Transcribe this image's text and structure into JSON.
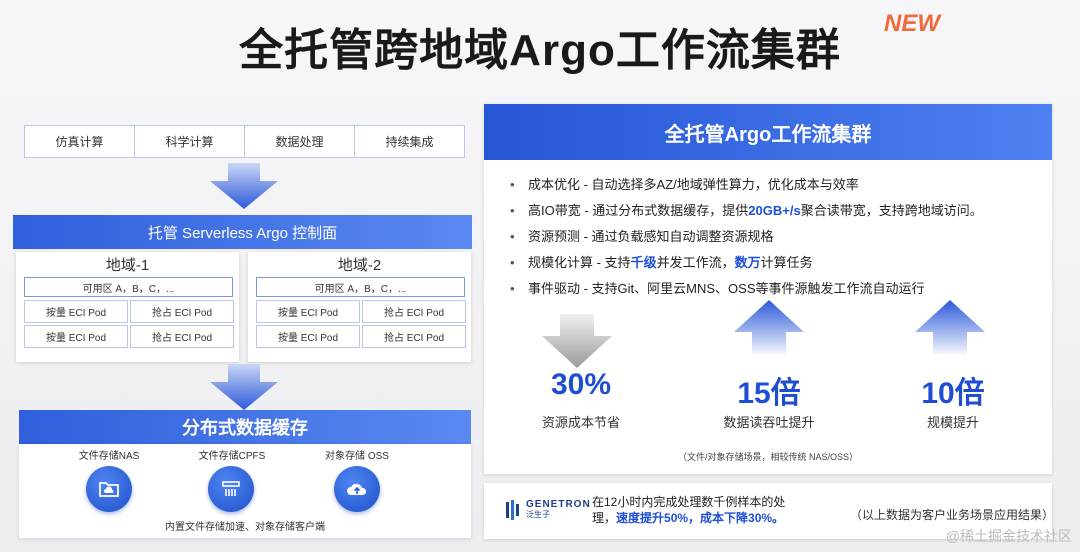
{
  "title": "全托管跨地域Argo工作流集群",
  "badge": "NEW",
  "tabs": [
    "仿真计算",
    "科学计算",
    "数据处理",
    "持续集成"
  ],
  "control_plane": "托管 Serverless Argo 控制面",
  "regions": [
    {
      "title": "地域-1",
      "az": "可用区 A，B，C，...",
      "pods": [
        "按量 ECI Pod",
        "抢占 ECI Pod",
        "按量 ECI Pod",
        "抢占 ECI Pod"
      ]
    },
    {
      "title": "地域-2",
      "az": "可用区 A，B，C，...",
      "pods": [
        "按量 ECI Pod",
        "抢占 ECI Pod",
        "按量 ECI Pod",
        "抢占 ECI Pod"
      ]
    }
  ],
  "cache": {
    "title": "分布式数据缓存",
    "stores": [
      {
        "label": "文件存储NAS",
        "icon": "folder-cloud-icon"
      },
      {
        "label": "文件存储CPFS",
        "icon": "file-storage-icon"
      },
      {
        "label": "对象存储 OSS",
        "icon": "cloud-upload-icon"
      }
    ],
    "footer": "内置文件存储加速、对象存储客户端"
  },
  "panel": {
    "title": "全托管Argo工作流集群",
    "bullets": [
      {
        "parts": [
          {
            "t": "成本优化 - 自动选择多AZ/地域弹性算力，优化成本与效率"
          }
        ]
      },
      {
        "parts": [
          {
            "t": "高IO带宽 - 通过分布式数据缓存，提供"
          },
          {
            "t": "20GB+/s",
            "hl": true
          },
          {
            "t": "聚合读带宽，支持跨地域访问。"
          }
        ]
      },
      {
        "parts": [
          {
            "t": "资源预测 - 通过负载感知自动调整资源规格"
          }
        ]
      },
      {
        "parts": [
          {
            "t": "规模化计算 - 支持"
          },
          {
            "t": "千级",
            "hl": true
          },
          {
            "t": "并发工作流，"
          },
          {
            "t": "数万",
            "hl": true
          },
          {
            "t": "计算任务"
          }
        ]
      },
      {
        "parts": [
          {
            "t": "事件驱动 - 支持Git、阿里云MNS、OSS等事件源触发工作流自动运行"
          }
        ]
      }
    ],
    "stats": [
      {
        "value": "30%",
        "label": "资源成本节省",
        "direction": "down"
      },
      {
        "value": "15倍",
        "label": "数据读吞吐提升",
        "direction": "up"
      },
      {
        "value": "10倍",
        "label": "规模提升",
        "direction": "up"
      }
    ],
    "note": "（文件/对象存储场景，相较传统 NAS/OSS）"
  },
  "case": {
    "logo_name": "GENETRON",
    "logo_cn": "泛生子",
    "text_a": "在12小时内完成处理数千例样本的处理，",
    "text_b": "速度提升50%，成本下降30%。",
    "disclaimer": "（以上数据为客户业务场景应用结果）"
  },
  "watermark": "@稀土掘金技术社区",
  "colors": {
    "accent": "#1f4ed0",
    "badge": "#f06a3c"
  }
}
